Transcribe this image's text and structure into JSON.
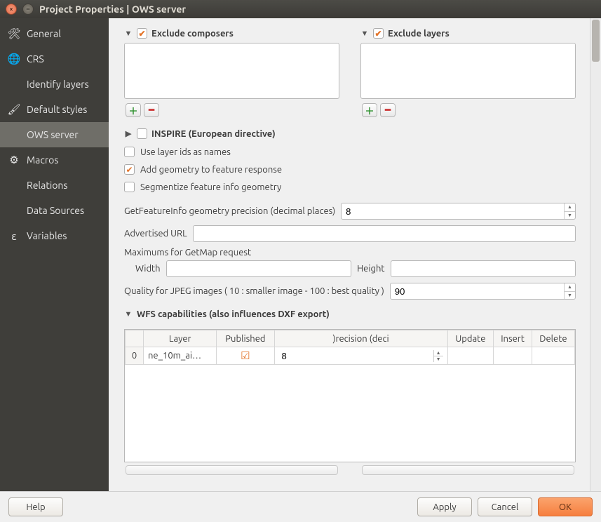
{
  "window": {
    "title": "Project Properties | OWS server"
  },
  "sidebar": {
    "items": [
      {
        "label": "General",
        "icon": "🛠"
      },
      {
        "label": "CRS",
        "icon": "🌐"
      },
      {
        "label": "Identify layers",
        "icon": ""
      },
      {
        "label": "Default styles",
        "icon": "🖌"
      },
      {
        "label": "OWS server",
        "icon": ""
      },
      {
        "label": "Macros",
        "icon": "⚙"
      },
      {
        "label": "Relations",
        "icon": ""
      },
      {
        "label": "Data Sources",
        "icon": ""
      },
      {
        "label": "Variables",
        "icon": "ε"
      }
    ],
    "active_index": 4
  },
  "sections": {
    "exclude_composers": {
      "label": "Exclude composers",
      "checked": true
    },
    "exclude_layers": {
      "label": "Exclude layers",
      "checked": true
    },
    "inspire": {
      "label": "INSPIRE (European directive)",
      "expanded": false
    },
    "wfs": {
      "label": "WFS capabilities (also influences DXF export)",
      "expanded": true
    }
  },
  "options": {
    "use_layer_ids": {
      "label": "Use layer ids as names",
      "checked": false
    },
    "add_geometry": {
      "label": "Add geometry to feature response",
      "checked": true
    },
    "segmentize": {
      "label": "Segmentize feature info geometry",
      "checked": false
    }
  },
  "fields": {
    "getfeatureinfo_precision": {
      "label": "GetFeatureInfo geometry precision (decimal places)",
      "value": "8"
    },
    "advertised_url": {
      "label": "Advertised URL",
      "value": ""
    },
    "maximums_label": "Maximums for GetMap request",
    "width": {
      "label": "Width",
      "value": ""
    },
    "height": {
      "label": "Height",
      "value": ""
    },
    "jpeg_quality": {
      "label": "Quality for JPEG images ( 10 : smaller image - 100 : best quality )",
      "value": "90"
    }
  },
  "wfs_table": {
    "headers": [
      "",
      "Layer",
      "Published",
      "recision (deci",
      "Update",
      "Insert",
      "Delete"
    ],
    "index_label_truncated": ")recision (deci",
    "rows": [
      {
        "idx": "0",
        "layer": "ne_10m_ai…",
        "published": true,
        "precision": "8",
        "update": "",
        "insert": "",
        "delete": ""
      }
    ]
  },
  "footer": {
    "help": "Help",
    "apply": "Apply",
    "cancel": "Cancel",
    "ok": "OK"
  }
}
